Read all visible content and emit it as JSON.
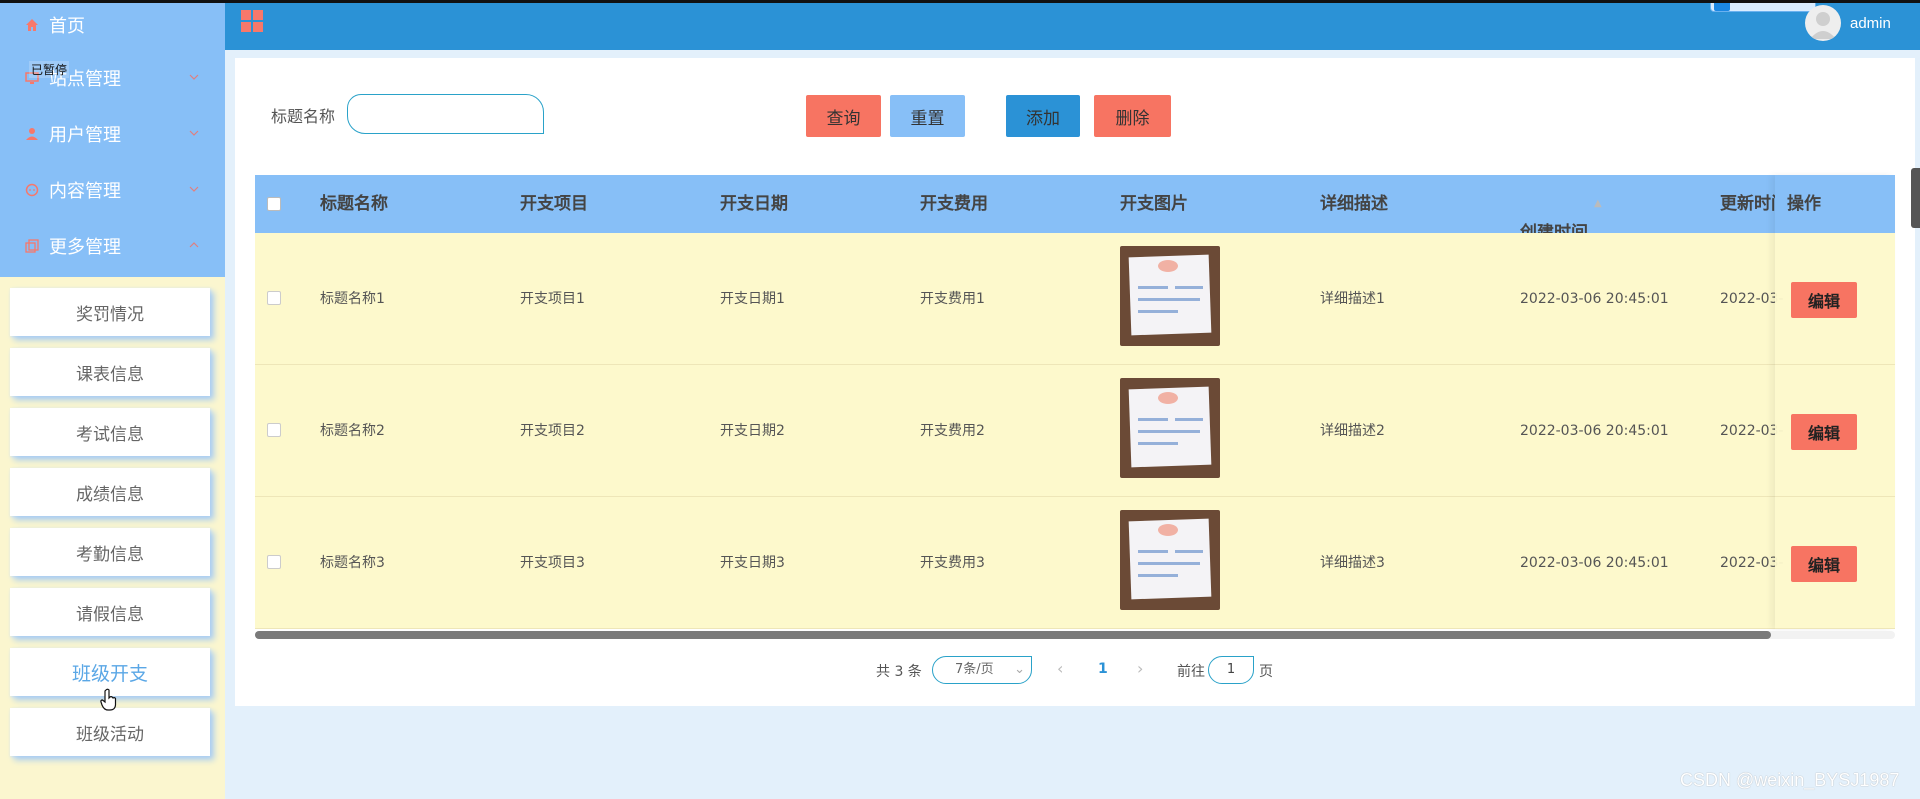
{
  "sidebar": {
    "menu": [
      {
        "label": "首页",
        "icon": "home-icon"
      },
      {
        "label": "站点管理",
        "icon": "monitor-icon"
      },
      {
        "label": "用户管理",
        "icon": "user-icon"
      },
      {
        "label": "内容管理",
        "icon": "chat-icon"
      },
      {
        "label": "更多管理",
        "icon": "copy-icon"
      }
    ],
    "tooltip": "已暂停",
    "submenu": [
      "奖罚情况",
      "课表信息",
      "考试信息",
      "成绩信息",
      "考勤信息",
      "请假信息",
      "班级开支",
      "班级活动"
    ],
    "active_submenu": "班级开支"
  },
  "header": {
    "username": "admin",
    "accent": "#2b92d6"
  },
  "search": {
    "label": "标题名称",
    "value": "",
    "buttons": {
      "query": "查询",
      "reset": "重置",
      "add": "添加",
      "delete": "删除"
    }
  },
  "table": {
    "columns": [
      "标题名称",
      "开支项目",
      "开支日期",
      "开支费用",
      "开支图片",
      "详细描述",
      "创建时间",
      "更新时间"
    ],
    "action_column": "操作",
    "rows": [
      {
        "title": "标题名称1",
        "item": "开支项目1",
        "date": "开支日期1",
        "cost": "开支费用1",
        "desc": "详细描述1",
        "created": "2022-03-06 20:45:01",
        "updated": "2022-03-"
      },
      {
        "title": "标题名称2",
        "item": "开支项目2",
        "date": "开支日期2",
        "cost": "开支费用2",
        "desc": "详细描述2",
        "created": "2022-03-06 20:45:01",
        "updated": "2022-03-"
      },
      {
        "title": "标题名称3",
        "item": "开支项目3",
        "date": "开支日期3",
        "cost": "开支费用3",
        "desc": "详细描述3",
        "created": "2022-03-06 20:45:01",
        "updated": "2022-03-"
      }
    ],
    "edit_label": "编辑"
  },
  "pagination": {
    "total": "共 3 条",
    "page_size": "7条/页",
    "current_page": "1",
    "goto_prefix": "前往",
    "goto_value": "1",
    "goto_suffix": "页"
  },
  "watermark": "CSDN @weixin_BYSJ1987",
  "colors": {
    "sidebar": "#87bff7",
    "row": "#fdf9cc",
    "danger": "#f77462"
  }
}
